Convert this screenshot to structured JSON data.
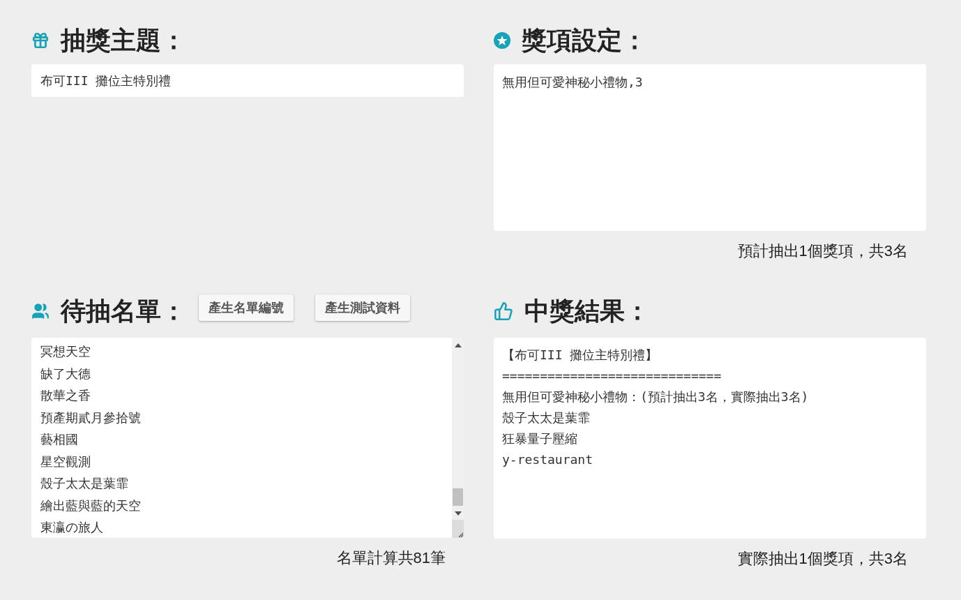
{
  "theme_section": {
    "title": "抽獎主題：",
    "value": "布可III 攤位主特別禮"
  },
  "prize_section": {
    "title": "獎項設定：",
    "value": "無用但可愛神秘小禮物,3",
    "summary": "預計抽出1個獎項，共3名"
  },
  "candidates_section": {
    "title": "待抽名單：",
    "buttons": [
      "產生名單編號",
      "產生測試資料"
    ],
    "entries": [
      "冥想天空",
      "缺了大德",
      "散華之香",
      "預產期貳月參拾號",
      "藝相國",
      "星空觀測",
      "殼子太太是葉霏",
      "繪出藍與藍的天空",
      "東瀛の旅人"
    ],
    "summary": "名單計算共81筆"
  },
  "result_section": {
    "title": "中獎結果：",
    "lines": [
      "【布可III 攤位主特別禮】",
      "=============================",
      "無用但可愛神秘小禮物：(預計抽出3名，實際抽出3名)",
      "殼子太太是葉霏",
      "狂暴量子壓縮",
      "y-restaurant"
    ],
    "summary": "實際抽出1個獎項，共3名"
  }
}
